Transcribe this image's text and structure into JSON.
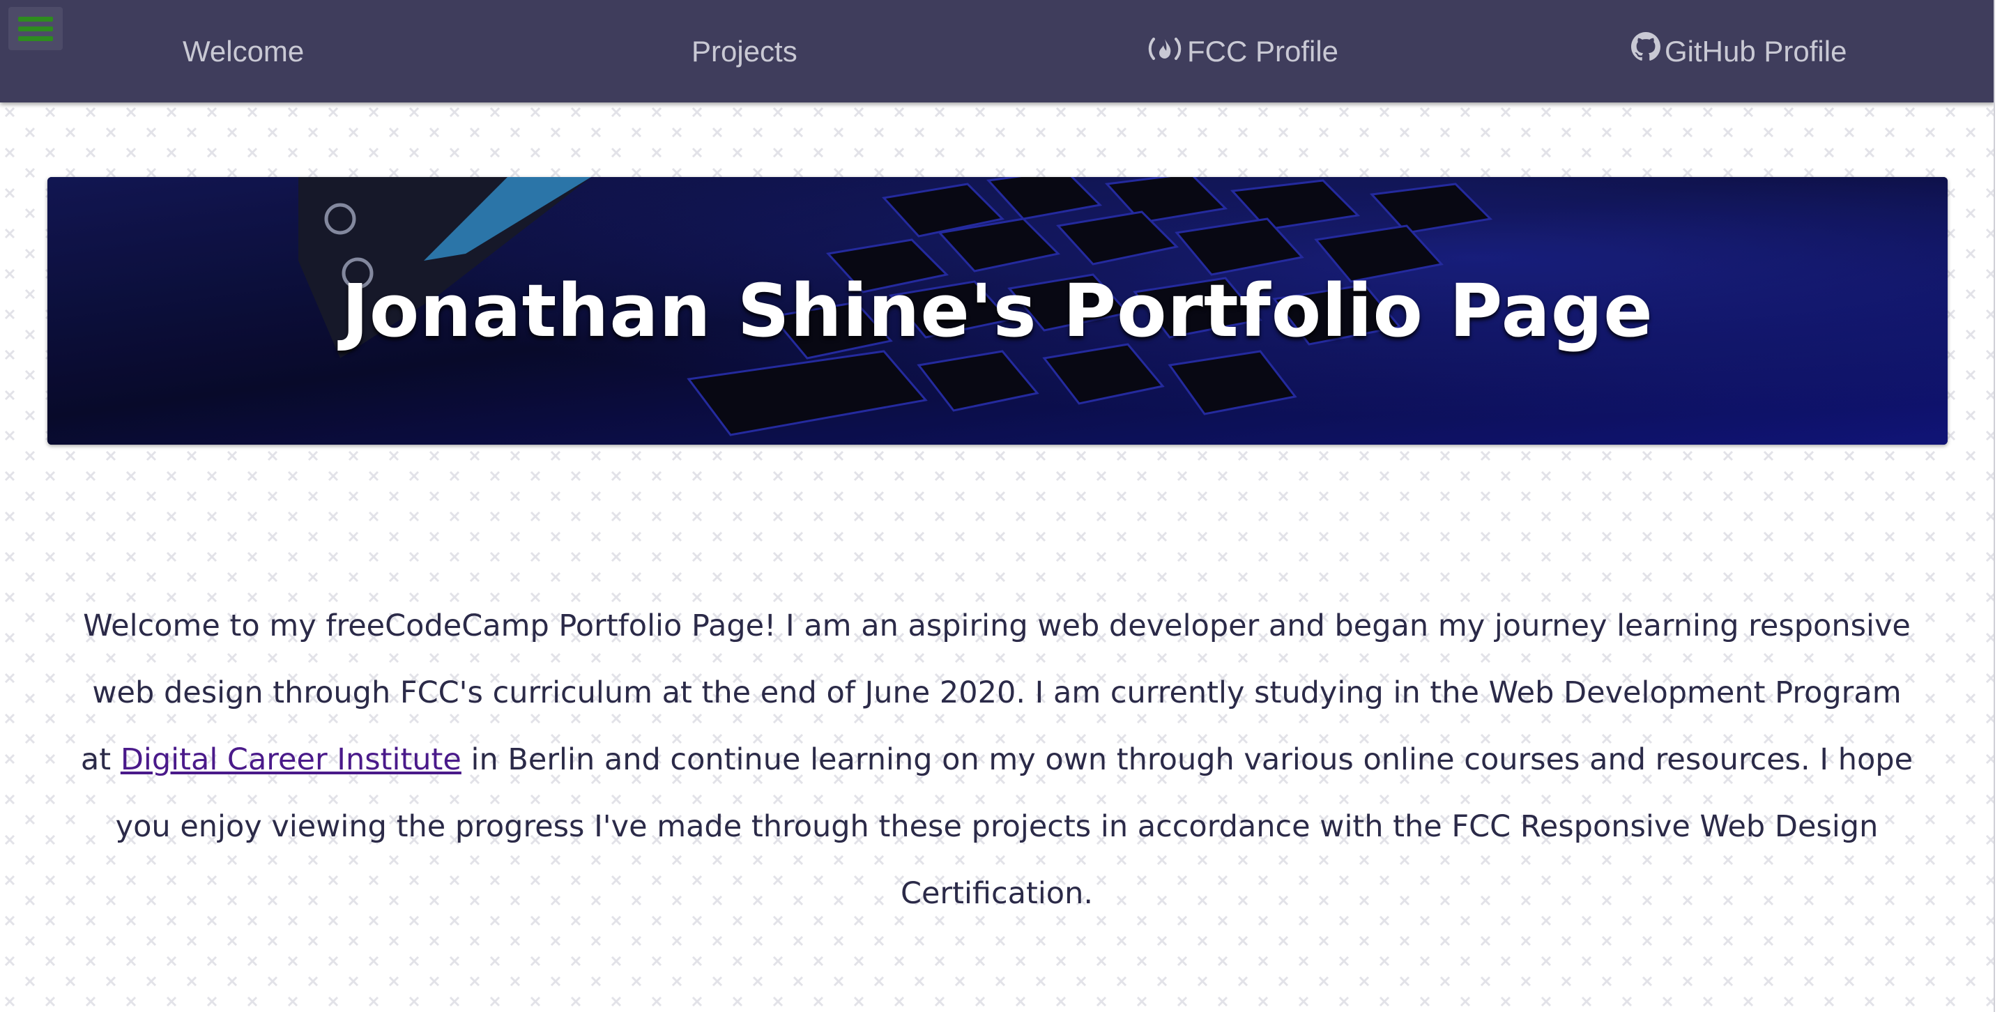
{
  "nav": {
    "menu_icon": "hamburger-menu-icon",
    "items": [
      {
        "label": "Welcome"
      },
      {
        "label": "Projects"
      },
      {
        "label": "FCC Profile",
        "icon": "freecodecamp-icon"
      },
      {
        "label": "GitHub Profile",
        "icon": "github-icon"
      }
    ]
  },
  "hero": {
    "title": "Jonathan Shine's Portfolio Page"
  },
  "intro": {
    "text_before": "Welcome to my freeCodeCamp Portfolio Page! I am an aspiring web developer and began my journey learning responsive web design through FCC's curriculum at the end of June 2020. I am currently studying in the Web Development Program at ",
    "link_text": "Digital Career Institute",
    "text_after": " in Berlin and continue learning on my own through various online courses and resources. I hope you enjoy viewing the progress I've made through these projects in accordance with the FCC Responsive Web Design Certification."
  },
  "colors": {
    "navbar": "#3f3d5c",
    "nav_text": "#c9c9d4",
    "menu_icon": "#2e8b1f",
    "body_text": "#2b2a48",
    "link": "#4a1a8a"
  }
}
